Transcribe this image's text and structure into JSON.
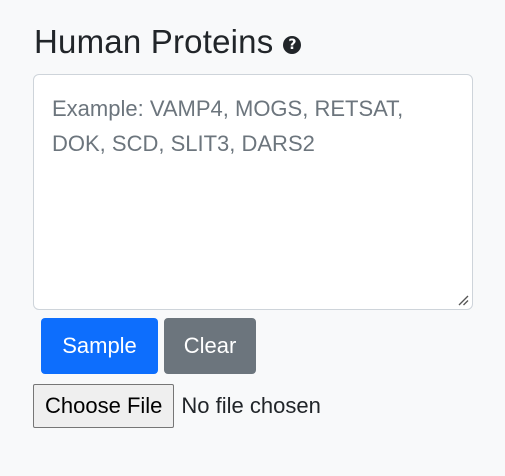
{
  "header": {
    "title": "Human Proteins",
    "help_icon_glyph": "?"
  },
  "input": {
    "value": "",
    "placeholder": "Example: VAMP4, MOGS, RETSAT,\nDOK, SCD, SLIT3, DARS2"
  },
  "buttons": {
    "sample_label": "Sample",
    "clear_label": "Clear"
  },
  "file_input": {
    "button_label": "Choose File",
    "status_text": "No file chosen"
  },
  "colors": {
    "primary": "#0d6efd",
    "secondary": "#6c757d",
    "text": "#212529",
    "placeholder": "#6c757d",
    "background": "#f8f9fa"
  }
}
